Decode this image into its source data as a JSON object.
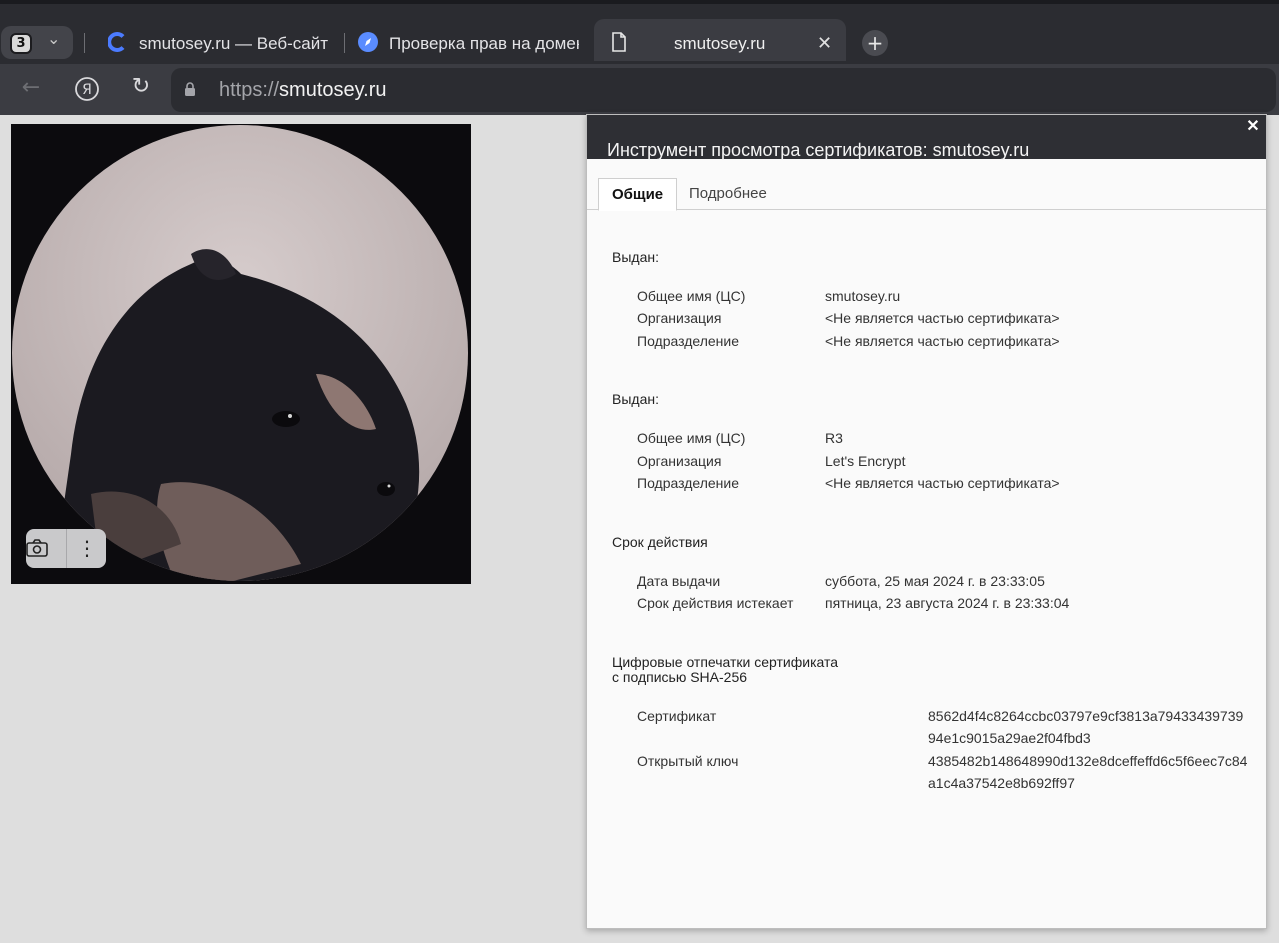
{
  "browser": {
    "tab_count": "3",
    "tabs": [
      {
        "label": "smutosey.ru — Веб-сайт |",
        "icon": "cloud-icon"
      },
      {
        "label": "Проверка прав на домен",
        "icon": "compass-icon"
      },
      {
        "label": "smutosey.ru",
        "icon": "document-icon",
        "active": true
      }
    ],
    "address": {
      "scheme": "https://",
      "host": "smutosey.ru"
    }
  },
  "image_tools": {
    "icons": [
      "camera-search-icon",
      "more-vertical-icon"
    ]
  },
  "cert_viewer": {
    "title": "Инструмент просмотра сертификатов: smutosey.ru",
    "tabs": {
      "general": "Общие",
      "details": "Подробнее"
    },
    "issued_to": {
      "heading": "Выдан:",
      "cn_label": "Общее имя (ЦС)",
      "cn_value": "smutosey.ru",
      "org_label": "Организация",
      "org_value": "<Не является частью сертификата>",
      "ou_label": "Подразделение",
      "ou_value": "<Не является частью сертификата>"
    },
    "issued_by": {
      "heading": "Выдан:",
      "cn_label": "Общее имя (ЦС)",
      "cn_value": "R3",
      "org_label": "Организация",
      "org_value": "Let's Encrypt",
      "ou_label": "Подразделение",
      "ou_value": "<Не является частью сертификата>"
    },
    "validity": {
      "heading": "Срок действия",
      "issued_label": "Дата выдачи",
      "issued_value": "суббота, 25 мая 2024 г. в 23:33:05",
      "expires_label": "Срок действия истекает",
      "expires_value": "пятница, 23 августа 2024 г. в 23:33:04"
    },
    "fingerprints": {
      "heading_line1": "Цифровые отпечатки сертификата",
      "heading_line2": "с подписью SHA-256",
      "cert_label": "Сертификат",
      "cert_value": "8562d4f4c8264ccbc03797e9cf3813a7943343973994e1c9015a29ae2f04fbd3",
      "key_label": "Открытый ключ",
      "key_value": "4385482b148648990d132e8dceffeffd6c5f6eec7c84a1c4a37542e8b692ff97"
    }
  }
}
